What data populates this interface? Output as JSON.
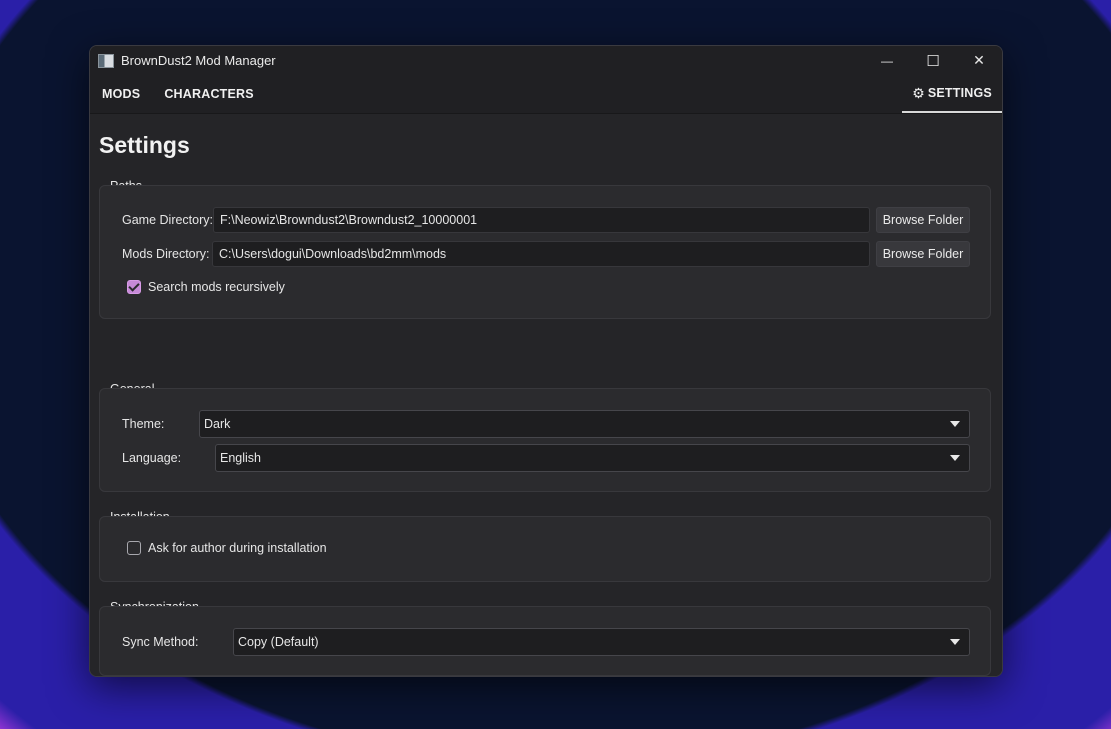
{
  "window": {
    "title": "BrownDust2 Mod Manager",
    "controls": {
      "minimize": "—",
      "maximize": "☐",
      "close": "✕"
    }
  },
  "nav": {
    "mods": "MODS",
    "characters": "CHARACTERS",
    "settings": "SETTINGS",
    "active": "settings"
  },
  "page": {
    "title": "Settings"
  },
  "paths": {
    "group_label": "Paths",
    "game_directory": {
      "label": "Game Directory:",
      "value": "F:\\Neowiz\\Browndust2\\Browndust2_10000001",
      "button": "Browse Folder"
    },
    "mods_directory": {
      "label": "Mods Directory:",
      "value": "C:\\Users\\dogui\\Downloads\\bd2mm\\mods",
      "button": "Browse Folder"
    },
    "search_recursive": {
      "label": "Search mods recursively",
      "checked": true
    }
  },
  "general": {
    "group_label": "General",
    "theme": {
      "label": "Theme:",
      "value": "Dark"
    },
    "language": {
      "label": "Language:",
      "value": "English"
    }
  },
  "installation": {
    "group_label": "Installation",
    "ask_author": {
      "label": "Ask for author during installation",
      "checked": false
    }
  },
  "synchronization": {
    "group_label": "Synchronization",
    "sync_method": {
      "label": "Sync Method:",
      "value": "Copy (Default)"
    }
  },
  "colors": {
    "accent_check": "#c78ad8",
    "window_bg": "#252528",
    "input_bg": "#1e1e20"
  }
}
